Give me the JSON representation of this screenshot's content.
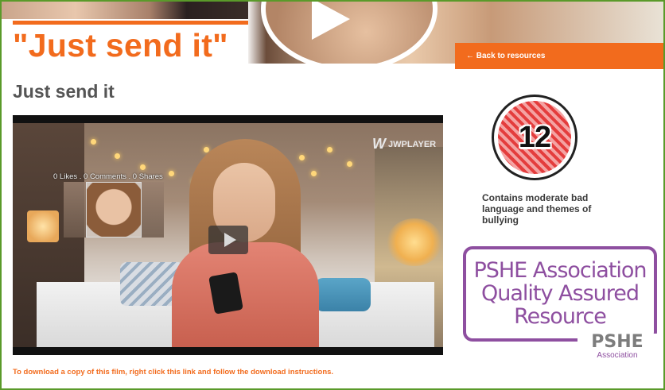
{
  "header": {
    "title": "\"Just send it\"",
    "back_link": "← Back to resources"
  },
  "page": {
    "title": "Just send it"
  },
  "player": {
    "brand": "JWPLAYER",
    "brand_mark": "W",
    "social_stats": "0 Likes . 0 Comments . 0 Shares"
  },
  "download": {
    "text": "To download a copy of this film, right click this link and follow the download instructions."
  },
  "rating": {
    "age": "12",
    "note": "Contains moderate bad language and themes of bullying"
  },
  "pshe": {
    "badge_lines": [
      "PSHE Association",
      "Quality Assured",
      "Resource"
    ],
    "logo_big": "PSHE",
    "logo_small": "Association"
  },
  "colors": {
    "accent": "#f26b1d",
    "pshe_purple": "#8e4fa0",
    "frame": "#5a9a2a"
  }
}
